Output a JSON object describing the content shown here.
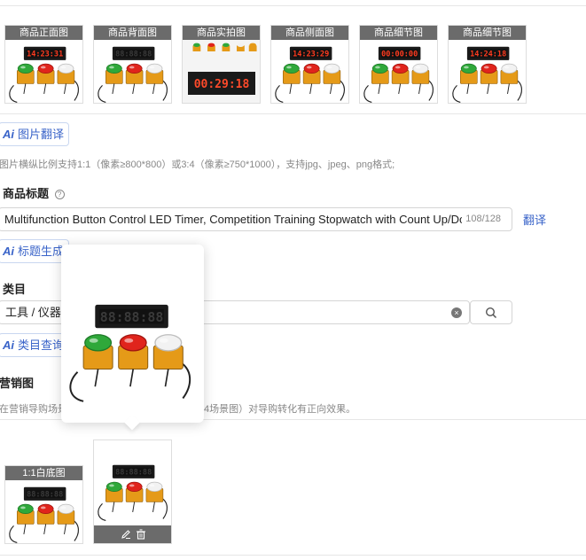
{
  "gallery": [
    {
      "caption": "商品正面图",
      "display": "14:23:31"
    },
    {
      "caption": "商品背面图",
      "display": "88:88:88"
    },
    {
      "caption": "商品实拍图",
      "display": "00:29:18"
    },
    {
      "caption": "商品侧面图",
      "display": "14:23:29"
    },
    {
      "caption": "商品细节图",
      "display": "00:00:00"
    },
    {
      "caption": "商品细节图",
      "display": "14:24:18"
    }
  ],
  "ai_translate": {
    "badge": "Ai",
    "label": "图片翻译"
  },
  "image_note": "图片横纵比例支持1:1（像素≥800*800）或3:4（像素≥750*1000），支持jpg、jpeg、png格式;",
  "title_field": {
    "label": "商品标题",
    "help_icon": "question-circle-icon",
    "value": "Multifunction Button Control LED Timer, Competition Training Stopwatch with Count Up/Do",
    "counter": "108/128",
    "translate": "翻译"
  },
  "ai_title": {
    "badge": "Ai",
    "label": "标题生成"
  },
  "category_field": {
    "label": "类目",
    "value": "工具 / 仪器",
    "clear_icon": "clear-circle-icon",
    "search_icon": "search-icon"
  },
  "ai_category": {
    "badge": "Ai",
    "label": "类目查询"
  },
  "marketing": {
    "label": "营销图",
    "note_left": "在营销导购场景",
    "note_right": "4场景图）对导购转化有正向效果。"
  },
  "white_bg": {
    "caption": "1:1白底图",
    "display": "88:88:88"
  },
  "popover": {
    "display": "88:88:88"
  },
  "edit_tools": {
    "edit_icon": "pencil-icon",
    "delete_icon": "trash-icon"
  }
}
